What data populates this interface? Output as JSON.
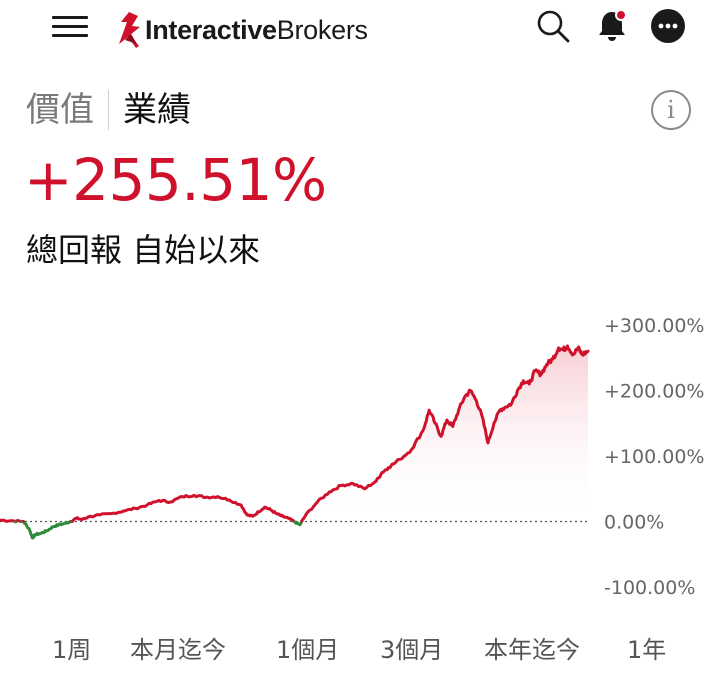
{
  "header": {
    "logo_bold": "Interactive",
    "logo_regular": "Brokers",
    "icons": [
      "menu-icon",
      "search-icon",
      "bell-icon",
      "more-icon"
    ],
    "brand_color": "#d0112b"
  },
  "tabs": [
    {
      "label": "價值",
      "active": false
    },
    {
      "label": "業績",
      "active": true
    }
  ],
  "info_label": "i",
  "total_return": "+255.51%",
  "subtitle": "總回報 自始以來",
  "periods": [
    {
      "label": "1周",
      "active": false
    },
    {
      "label": "本月迄今",
      "active": false
    },
    {
      "label": "1個月",
      "active": false
    },
    {
      "label": "3個月",
      "active": false
    },
    {
      "label": "本年迄今",
      "active": false
    },
    {
      "label": "1年",
      "active": false
    }
  ],
  "chart_data": {
    "type": "line",
    "y_tick_labels": [
      "+300.00%",
      "+200.00%",
      "+100.00%",
      "0.00%",
      "-100.00%"
    ],
    "ylim": [
      -100,
      300
    ],
    "x_range": [
      0,
      100
    ],
    "baseline": 0,
    "colors": {
      "positive": "#d0112b",
      "negative": "#2e8b3a",
      "area_top": "#f6c9d0",
      "baseline": "#555555"
    },
    "series": [
      {
        "x": [
          0,
          2,
          4,
          5,
          5.5,
          6,
          7,
          8,
          9,
          10,
          11,
          12,
          13,
          14,
          15,
          17,
          19,
          21,
          23,
          25,
          27,
          29,
          31,
          33,
          35,
          37,
          39,
          41,
          42,
          43,
          44,
          45,
          46,
          47,
          48,
          49,
          50,
          51,
          52,
          54,
          56,
          58,
          60,
          62,
          64,
          65,
          66,
          68,
          70,
          72,
          73,
          74,
          75,
          76,
          77,
          78,
          79,
          80,
          81,
          82,
          83,
          84,
          85,
          86,
          87,
          88,
          89,
          90,
          91,
          92,
          93,
          94,
          95,
          95.8,
          96.5,
          97.5,
          98.3,
          99,
          100
        ],
        "y": [
          2,
          1,
          0,
          -12,
          -25,
          -20,
          -18,
          -14,
          -8,
          -5,
          -3,
          0,
          5,
          3,
          7,
          10,
          12,
          16,
          20,
          25,
          32,
          30,
          38,
          40,
          37,
          38,
          33,
          25,
          10,
          8,
          15,
          22,
          18,
          12,
          8,
          5,
          0,
          -5,
          10,
          30,
          45,
          55,
          58,
          50,
          62,
          75,
          82,
          95,
          110,
          140,
          170,
          150,
          130,
          155,
          145,
          170,
          190,
          200,
          185,
          160,
          120,
          150,
          170,
          175,
          180,
          200,
          215,
          210,
          230,
          225,
          240,
          248,
          265,
          262,
          268,
          255,
          265,
          255,
          260
        ]
      }
    ]
  }
}
